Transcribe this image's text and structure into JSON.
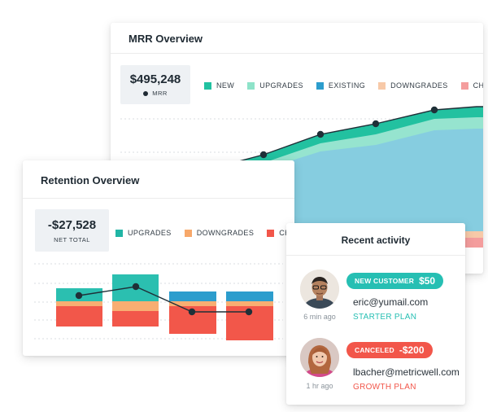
{
  "mrr": {
    "title": "MRR Overview",
    "total": "$495,248",
    "total_label": "MRR",
    "legend": [
      {
        "label": "NEW",
        "color": "#21c2a1"
      },
      {
        "label": "UPGRADES",
        "color": "#8ee3c9"
      },
      {
        "label": "EXISTING",
        "color": "#2c9dcd"
      },
      {
        "label": "DOWNGRADES",
        "color": "#f7c9a8"
      },
      {
        "label": "CHURN",
        "color": "#f49d9d"
      }
    ]
  },
  "retention": {
    "title": "Retention Overview",
    "total": "-$27,528",
    "total_label": "NET TOTAL",
    "legend": [
      {
        "label": "UPGRADES",
        "color": "#21b5a5"
      },
      {
        "label": "DOWNGRADES",
        "color": "#f7a86a"
      },
      {
        "label": "CHURN",
        "color": "#f2564a"
      }
    ]
  },
  "activity": {
    "title": "Recent activity",
    "items": [
      {
        "badge": "NEW CUSTOMER",
        "amount": "$50",
        "badge_color": "#26bfb3",
        "email": "eric@yumail.com",
        "plan": "STARTER PLAN",
        "plan_color": "#26bfb3",
        "time": "6 min ago"
      },
      {
        "badge": "CANCELED",
        "amount": "-$200",
        "badge_color": "#f2564a",
        "email": "lbacher@metricwell.com",
        "plan": "GROWTH PLAN",
        "plan_color": "#f2564a",
        "time": "1 hr ago"
      }
    ]
  }
}
